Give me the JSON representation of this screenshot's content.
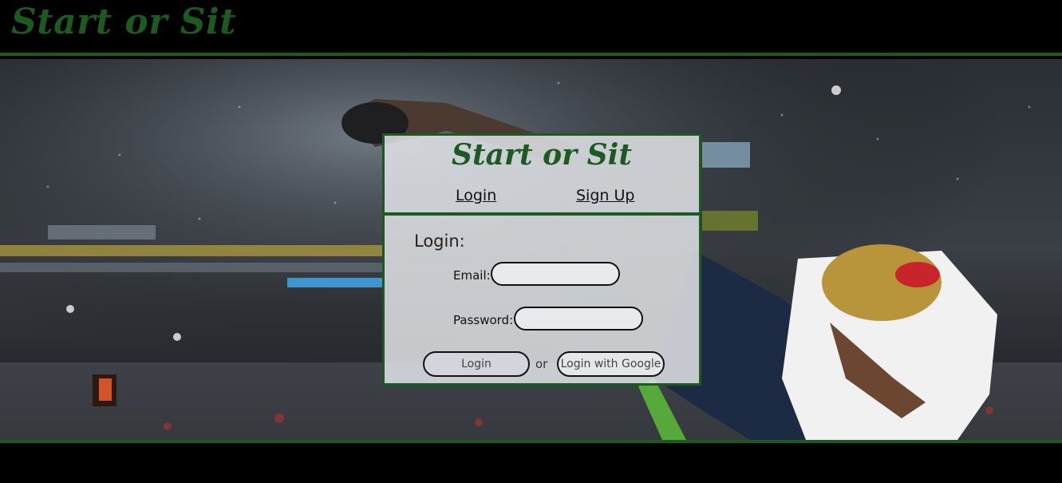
{
  "app": {
    "brand": "Start or Sit"
  },
  "card": {
    "brand": "Start or Sit",
    "tabs": {
      "login": "Login",
      "signup": "Sign Up"
    },
    "form": {
      "title": "Login:",
      "email_label": "Email:",
      "password_label": "Password:",
      "email_value": "",
      "password_value": "",
      "login_button": "Login",
      "or_text": "or",
      "google_button": "Login with Google"
    }
  },
  "colors": {
    "brand_green": "#1d5a22",
    "header_bg": "#000000",
    "card_bg": "#e1e3e6"
  }
}
